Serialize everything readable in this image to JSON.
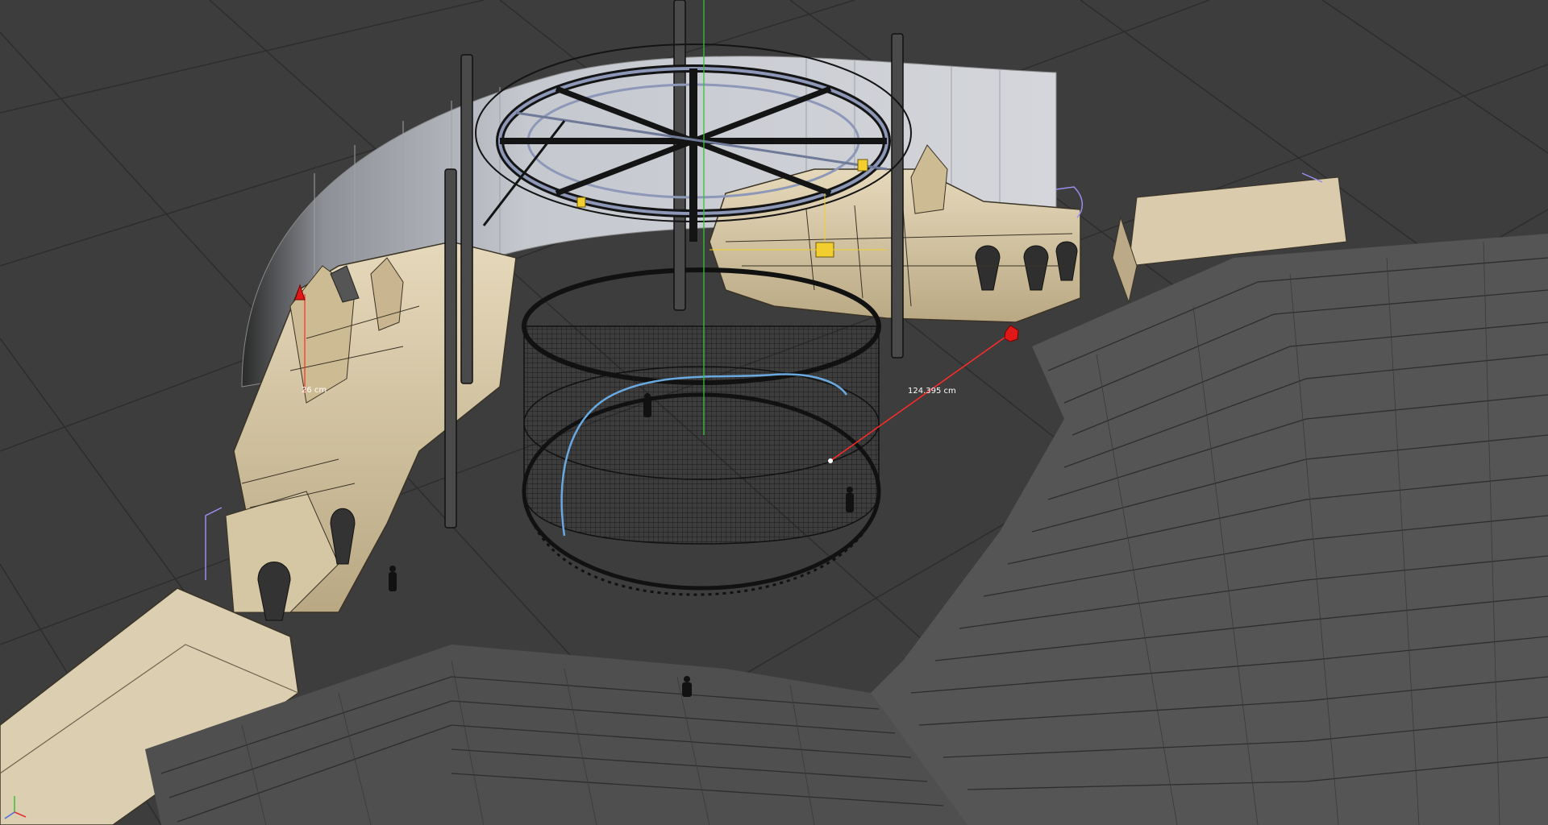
{
  "viewport": {
    "measurement_label": "124.395 cm",
    "height_label": "26 cm"
  },
  "colors": {
    "background": "#3a3a3a",
    "grid": "#2c2c2c",
    "wireframe": "#151515",
    "stone": "#d8c9a8",
    "wall": "#b9bcc3",
    "stairs": "#5a5a5a",
    "measure": "#ff2a2a",
    "spline": "#6aa9e0",
    "guide": "#9a8ff0",
    "light": "#f2cf2e",
    "axis_y": "#35c435"
  },
  "icons": {
    "handle": "red-handle-icon",
    "light": "light-icon",
    "axis": "axis-gizmo-icon"
  }
}
